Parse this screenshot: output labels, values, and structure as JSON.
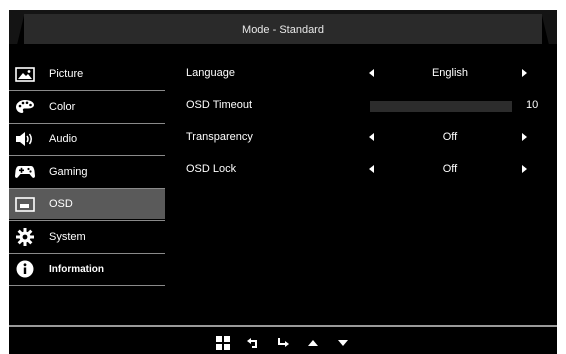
{
  "header": {
    "title": "Mode - Standard"
  },
  "sidebar": {
    "items": [
      {
        "label": "Picture",
        "icon": "picture-icon",
        "active": false
      },
      {
        "label": "Color",
        "icon": "palette-icon",
        "active": false
      },
      {
        "label": "Audio",
        "icon": "speaker-icon",
        "active": false
      },
      {
        "label": "Gaming",
        "icon": "gamepad-icon",
        "active": false
      },
      {
        "label": "OSD",
        "icon": "osd-icon",
        "active": true
      },
      {
        "label": "System",
        "icon": "gear-icon",
        "active": false
      },
      {
        "label": "Information",
        "icon": "info-icon",
        "active": false
      }
    ]
  },
  "settings": {
    "language": {
      "label": "Language",
      "value": "English"
    },
    "osd_timeout": {
      "label": "OSD Timeout",
      "value": "10",
      "level": 0
    },
    "transparency": {
      "label": "Transparency",
      "value": "Off"
    },
    "osd_lock": {
      "label": "OSD Lock",
      "value": "Off"
    }
  },
  "footer": {
    "buttons": [
      "menu-icon",
      "back-icon",
      "enter-icon",
      "up-icon",
      "down-icon"
    ]
  },
  "colors": {
    "background": "#000000",
    "active_item": "#5a5a5a",
    "divider": "#8a8a8a",
    "header": "#2a2a2a"
  }
}
